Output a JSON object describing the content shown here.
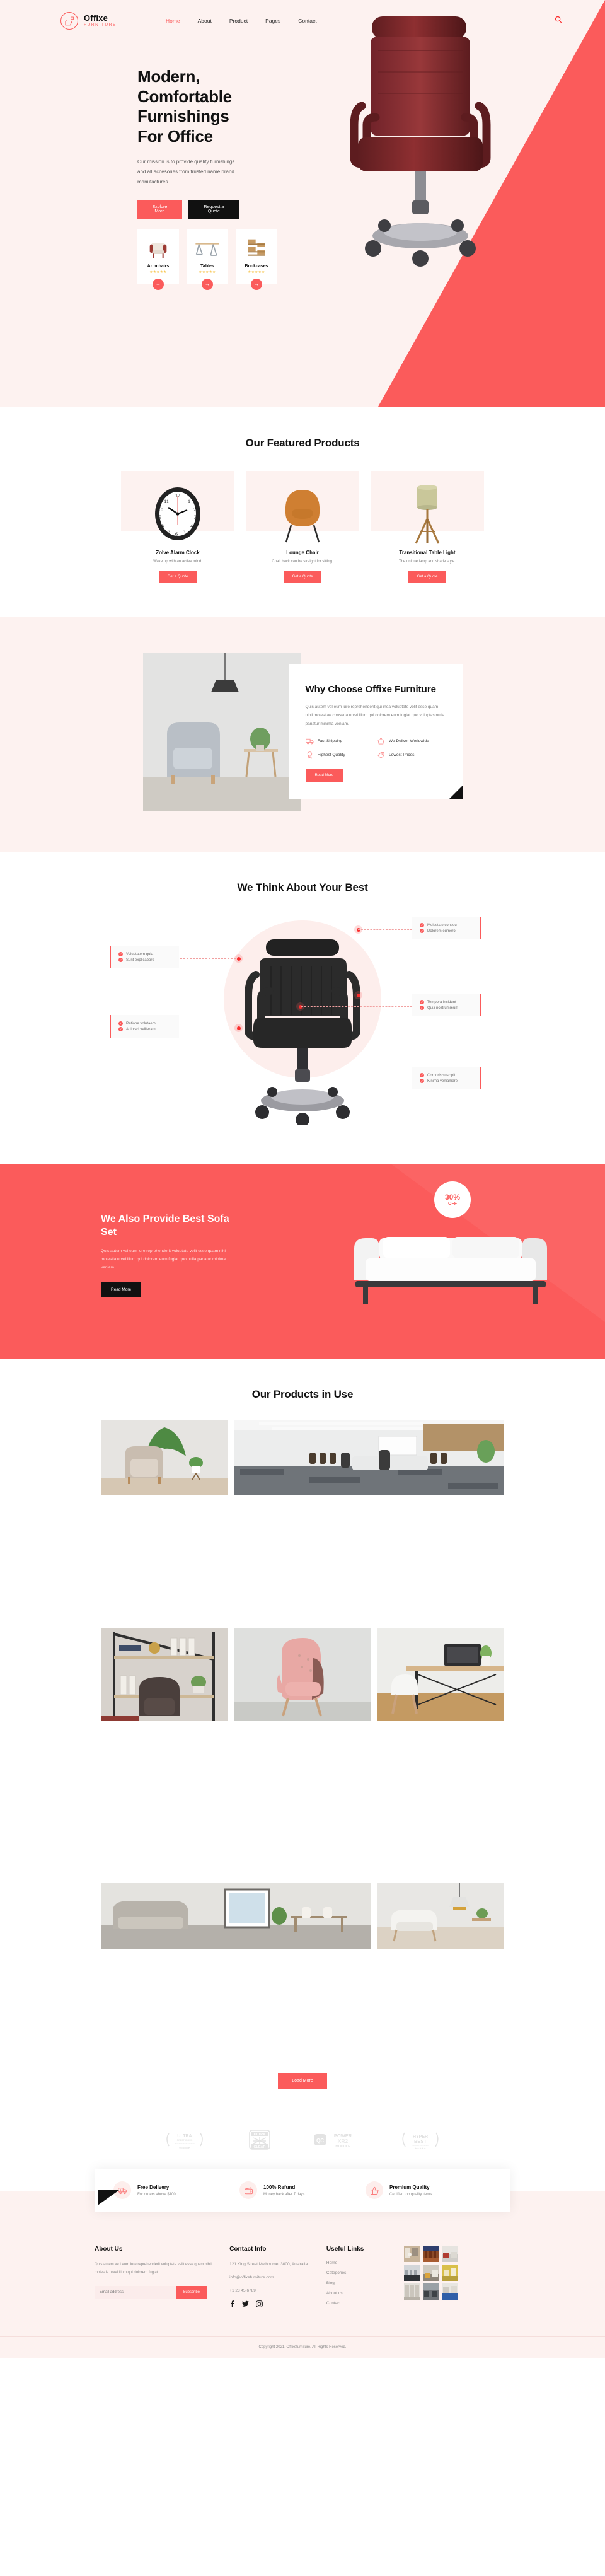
{
  "brand": {
    "name": "Offixe",
    "sub": "FURNITURE"
  },
  "nav": {
    "items": [
      {
        "label": "Home",
        "active": true
      },
      {
        "label": "About",
        "active": false
      },
      {
        "label": "Product",
        "active": false
      },
      {
        "label": "Pages",
        "active": false
      },
      {
        "label": "Contact",
        "active": false
      }
    ],
    "search_icon": "search-icon"
  },
  "hero": {
    "title": "Modern, Comfortable Furnishings For Office",
    "desc": "Our mission is to provide quality furnishings and all accesories from trusted name brand manufactures",
    "primary_btn": "Explore More",
    "secondary_btn": "Request a Quote",
    "categories": [
      {
        "name": "Armchairs",
        "stars": "★★★★★",
        "arrow": "→"
      },
      {
        "name": "Tables",
        "stars": "★★★★★",
        "arrow": "→"
      },
      {
        "name": "Bookcases",
        "stars": "★★★★★",
        "arrow": "→"
      }
    ]
  },
  "featured": {
    "title": "Our Featured Products",
    "products": [
      {
        "name": "Zolve Alarm Clock",
        "desc": "Wake up with an active mind.",
        "btn": "Get a Quote"
      },
      {
        "name": "Lounge Chair",
        "desc": "Chair back can be straight for sitting.",
        "btn": "Get a Quote"
      },
      {
        "name": "Transitional Table Light",
        "desc": "The unique lamp and shade style.",
        "btn": "Get a Quote"
      }
    ]
  },
  "why": {
    "title": "Why Choose Offixe Furniture",
    "text": "Quis autem vel eum iure reprehenderit qui inea voluptate velit esse quam nihil molestiae conseua urvel illum qui dolorem eum fugiat quo voluptas nulla pariatur minima veniam.",
    "features": [
      {
        "label": "Fast Shipping",
        "icon": "truck-icon"
      },
      {
        "label": "We Deliver Worldwide",
        "icon": "basket-icon"
      },
      {
        "label": "Highest Quality",
        "icon": "medal-icon"
      },
      {
        "label": "Lowest Prices",
        "icon": "price-tag-icon"
      }
    ],
    "btn": "Read More"
  },
  "think": {
    "title": "We Think About Your Best",
    "hotspots": [
      {
        "lines": [
          "Voluptatem quia",
          "Sunt explicabore"
        ],
        "side": "left"
      },
      {
        "lines": [
          "Molestiae conseu",
          "Dolorem eumero"
        ],
        "side": "right"
      },
      {
        "lines": [
          "Ratione volutaem",
          "Adipisci veliteram"
        ],
        "side": "left"
      },
      {
        "lines": [
          "Tempora incidunt",
          "Quis nostrumreum"
        ],
        "side": "right"
      },
      {
        "lines": [
          "Corporis suscipit",
          "Kinima veniamare"
        ],
        "side": "right"
      }
    ]
  },
  "sofa": {
    "title": "We Also Provide Best Sofa Set",
    "text": "Quis autem vel eum iure reprehenderit voluptate velit esse quam nihil molestia urvel illum qui dolorem eum fugiat quo nulla pariatur minima veniam.",
    "btn": "Read More",
    "badge_pct": "30%",
    "badge_off": "OFF"
  },
  "gallery": {
    "title": "Our Products in Use",
    "load_more": "Load More"
  },
  "brands": [
    {
      "line1": "ULTRA",
      "line2": "PRESTIGIOUS",
      "line3": "BEST OF THE WORLD",
      "line4": "WINNER"
    },
    {
      "line1": "ULTRA",
      "line2": "CLEAR"
    },
    {
      "line1": "QC",
      "line2": "POWER",
      "line3": "XR2",
      "line4": "MODULE"
    },
    {
      "line1": "HYPER",
      "line2": "BEST",
      "line3": "AWARD WINNING"
    }
  ],
  "services": [
    {
      "title": "Free Delivery",
      "sub": "For orders above $100",
      "icon": "delivery-truck-icon"
    },
    {
      "title": "100% Refund",
      "sub": "Money back after 7 days",
      "icon": "wallet-icon"
    },
    {
      "title": "Premium Quality",
      "sub": "Certified top quality items",
      "icon": "thumbs-up-icon"
    }
  ],
  "footer": {
    "about": {
      "title": "About Us",
      "text": "Quis autem ve l eum iure reprehenderit voluptate velit esse quam nihil molestia urvel illum qui dolorem fugiat.",
      "email_placeholder": "Email address",
      "subscribe_btn": "Subscribe"
    },
    "contact": {
      "title": "Contact Info",
      "address": "121 King Street Melbourne, 3000, Australia",
      "email": "info@offixefurniture.com",
      "phone": "+1 23 45 6789",
      "socials": [
        "facebook-icon",
        "twitter-icon",
        "instagram-icon"
      ]
    },
    "links": {
      "title": "Useful Links",
      "items": [
        "Home",
        "Categories",
        "Blog",
        "About us",
        "Contact"
      ]
    },
    "copyright": "Copyright 2021, Offixefurniture. All Rights Reserved."
  },
  "colors": {
    "accent": "#fb5b5b",
    "cream": "#fdf2f0",
    "dark": "#111111"
  }
}
